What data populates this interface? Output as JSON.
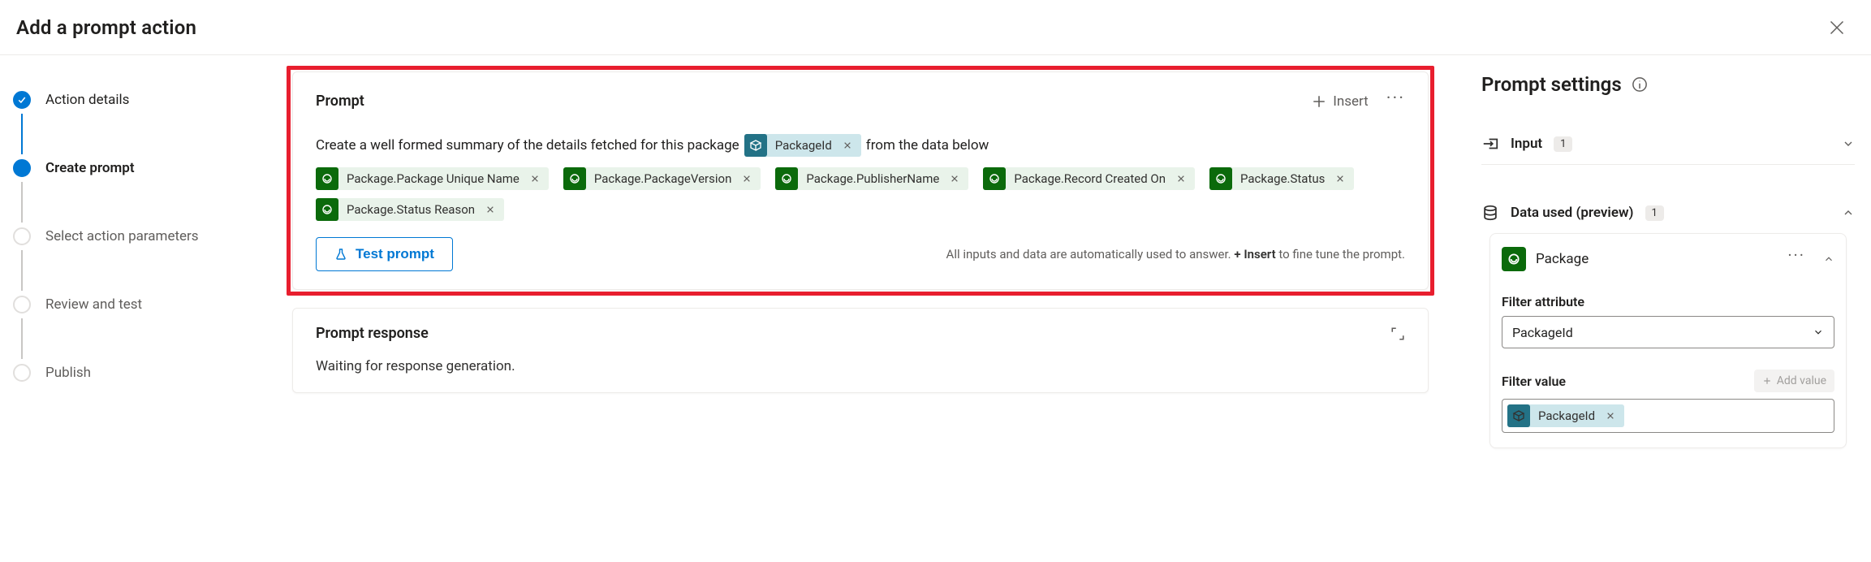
{
  "header": {
    "title": "Add a prompt action"
  },
  "stepper": {
    "steps": [
      {
        "label": "Action details",
        "state": "done"
      },
      {
        "label": "Create prompt",
        "state": "current"
      },
      {
        "label": "Select action parameters",
        "state": "pending"
      },
      {
        "label": "Review and test",
        "state": "pending"
      },
      {
        "label": "Publish",
        "state": "pending"
      }
    ]
  },
  "prompt_card": {
    "title": "Prompt",
    "insert_label": "Insert",
    "text_before": "Create a well formed summary of the details fetched for this package",
    "text_after": "from the data below",
    "input_chip": {
      "label": "PackageId"
    },
    "data_chips": [
      {
        "label": "Package.Package Unique Name"
      },
      {
        "label": "Package.PackageVersion"
      },
      {
        "label": "Package.PublisherName"
      },
      {
        "label": "Package.Record Created On"
      },
      {
        "label": "Package.Status"
      },
      {
        "label": "Package.Status Reason"
      }
    ],
    "test_label": "Test prompt",
    "hint_before": "All inputs and data are automatically used to answer.",
    "hint_bold": "+ Insert",
    "hint_after": "to fine tune the prompt."
  },
  "response_card": {
    "title": "Prompt response",
    "status": "Waiting for response generation."
  },
  "settings": {
    "title": "Prompt settings",
    "input_section": {
      "label": "Input",
      "count": "1"
    },
    "data_section": {
      "label": "Data used (preview)",
      "count": "1",
      "entity": {
        "name": "Package",
        "filter_attribute_label": "Filter attribute",
        "filter_attribute_value": "PackageId",
        "filter_value_label": "Filter value",
        "add_value_label": "Add value",
        "filter_value_chip": "PackageId"
      }
    }
  }
}
